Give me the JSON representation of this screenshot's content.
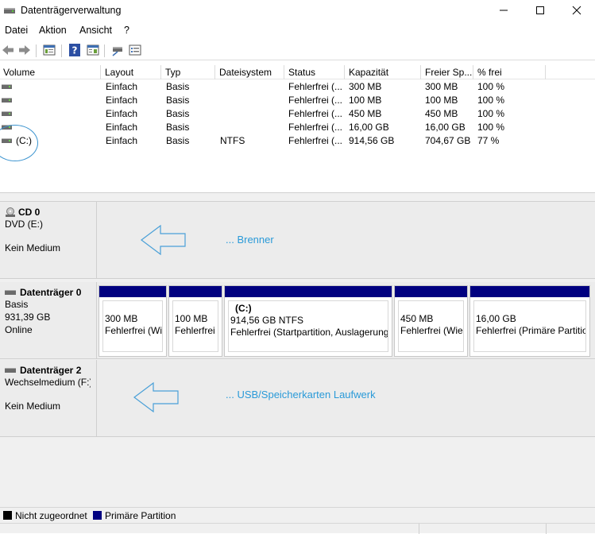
{
  "window": {
    "title": "Datenträgerverwaltung",
    "minimize": "—",
    "maximize": "☐",
    "close": "✕"
  },
  "menu": [
    "Datei",
    "Aktion",
    "Ansicht",
    "?"
  ],
  "toolbar": {
    "buttons": [
      "back-icon",
      "forward-icon",
      "properties-icon",
      "help-icon",
      "console-icon",
      "connect-icon",
      "list-icon"
    ]
  },
  "volume_table": {
    "columns": [
      "Volume",
      "Layout",
      "Typ",
      "Dateisystem",
      "Status",
      "Kapazität",
      "Freier Sp...",
      "% frei"
    ],
    "rows": [
      {
        "volume": "",
        "layout": "Einfach",
        "typ": "Basis",
        "fs": "",
        "status": "Fehlerfrei (...",
        "cap": "300 MB",
        "free": "300 MB",
        "pct": "100 %"
      },
      {
        "volume": "",
        "layout": "Einfach",
        "typ": "Basis",
        "fs": "",
        "status": "Fehlerfrei (...",
        "cap": "100 MB",
        "free": "100 MB",
        "pct": "100 %"
      },
      {
        "volume": "",
        "layout": "Einfach",
        "typ": "Basis",
        "fs": "",
        "status": "Fehlerfrei (...",
        "cap": "450 MB",
        "free": "450 MB",
        "pct": "100 %"
      },
      {
        "volume": "",
        "layout": "Einfach",
        "typ": "Basis",
        "fs": "",
        "status": "Fehlerfrei (...",
        "cap": "16,00 GB",
        "free": "16,00 GB",
        "pct": "100 %"
      },
      {
        "volume": "(C:)",
        "layout": "Einfach",
        "typ": "Basis",
        "fs": "NTFS",
        "status": "Fehlerfrei (...",
        "cap": "914,56 GB",
        "free": "704,67 GB",
        "pct": "77 %"
      }
    ]
  },
  "disks": {
    "cd0": {
      "title": "CD 0",
      "line1": "DVD (E:)",
      "line2": "Kein Medium",
      "annotation": "... Brenner"
    },
    "disk0": {
      "title": "Datenträger 0",
      "line1": "Basis",
      "line2": "931,39 GB",
      "line3": "Online",
      "partitions": [
        {
          "name": "",
          "size": "300 MB",
          "status": "Fehlerfrei (Wie"
        },
        {
          "name": "",
          "size": "100 MB",
          "status": "Fehlerfrei (E"
        },
        {
          "name": "(C:)",
          "size": "914,56 GB NTFS",
          "status": "Fehlerfrei (Startpartition, Auslagerung"
        },
        {
          "name": "",
          "size": "450 MB",
          "status": "Fehlerfrei (Wiec"
        },
        {
          "name": "",
          "size": "16,00 GB",
          "status": "Fehlerfrei (Primäre Partitio"
        }
      ]
    },
    "disk2": {
      "title": "Datenträger 2",
      "line1": "Wechselmedium (F:)",
      "line2": "Kein Medium",
      "annotation": "... USB/Speicherkarten Laufwerk"
    }
  },
  "legend": {
    "unallocated": "Nicht zugeordnet",
    "primary": "Primäre Partition",
    "unallocated_color": "#000000",
    "primary_color": "#000080"
  },
  "colors": {
    "partition_bar": "#000080",
    "annotation": "#2a9ad8"
  }
}
